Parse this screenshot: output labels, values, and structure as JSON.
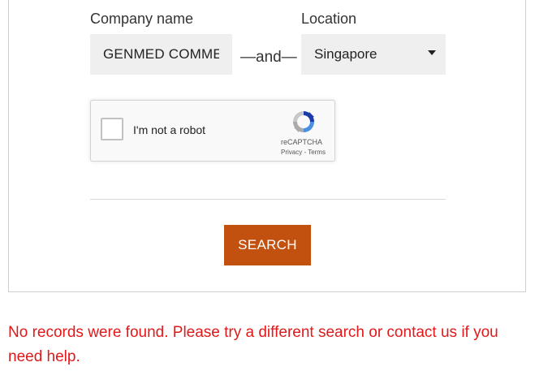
{
  "form": {
    "company_label": "Company name",
    "company_value": "GENMED COMMEF",
    "connector": "—and—",
    "location_label": "Location",
    "location_value": "Singapore"
  },
  "captcha": {
    "checkbox_label": "I'm not a robot",
    "brand": "reCAPTCHA",
    "links": "Privacy - Terms"
  },
  "actions": {
    "search_label": "SEARCH",
    "search_color": "#c2500e"
  },
  "message": {
    "error_text": "No records were found. Please try a different search or contact us if you need help.",
    "error_color": "#e0191b"
  }
}
